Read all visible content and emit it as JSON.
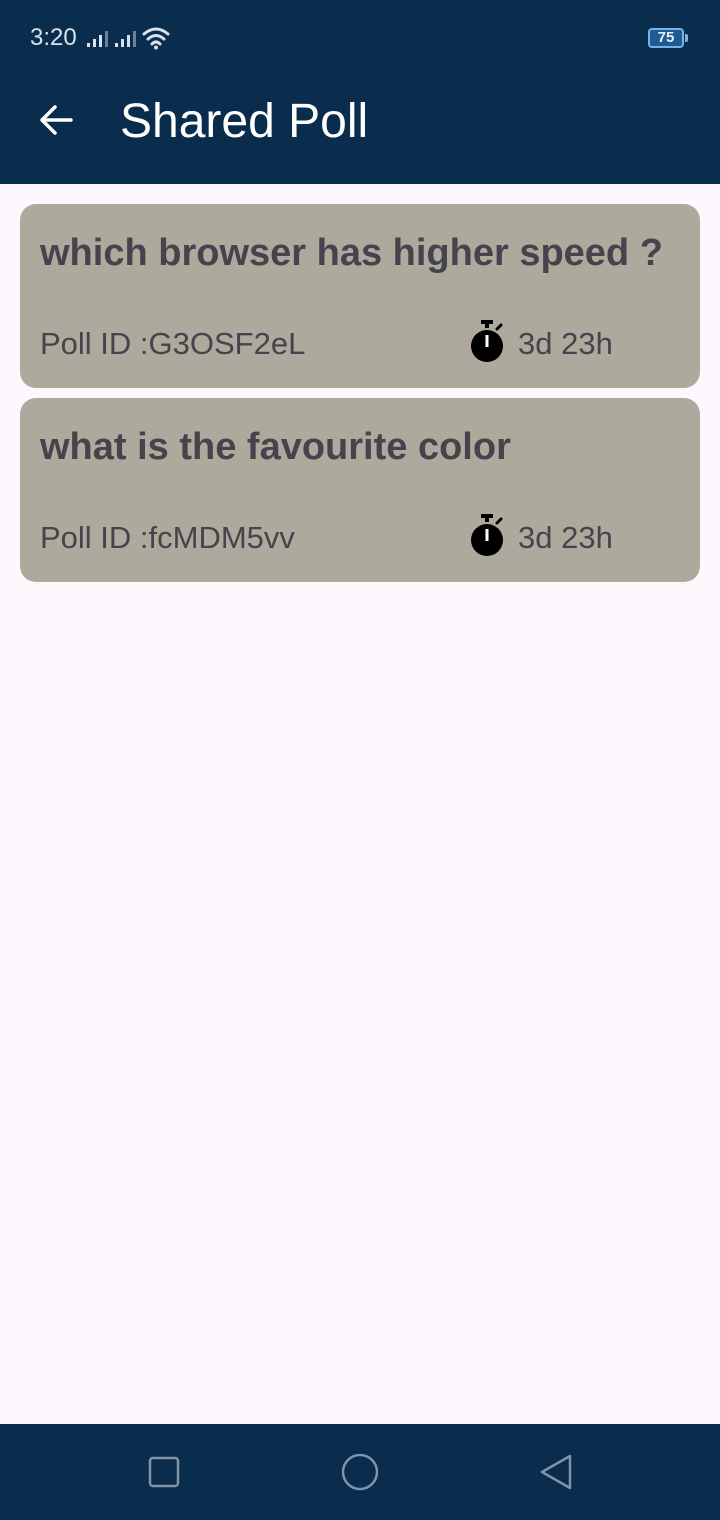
{
  "status_bar": {
    "time": "3:20",
    "battery": "75"
  },
  "app_bar": {
    "title": "Shared Poll",
    "back_icon": "arrow-left-icon"
  },
  "polls": [
    {
      "question": "which browser has higher speed ?",
      "poll_id": "Poll ID :G3OSF2eL",
      "time_left": "3d 23h",
      "icon": "stopwatch-icon"
    },
    {
      "question": "what is the favourite color",
      "poll_id": "Poll ID :fcMDM5vv",
      "time_left": "3d 23h",
      "icon": "stopwatch-icon"
    }
  ],
  "nav_bar": {
    "recent_icon": "square-icon",
    "home_icon": "circle-icon",
    "back_icon": "triangle-back-icon"
  },
  "colors": {
    "app_bar": "#0b2d4d",
    "card": "#adaa9d",
    "card_text": "#45434c",
    "background": "#fdf8fd"
  }
}
